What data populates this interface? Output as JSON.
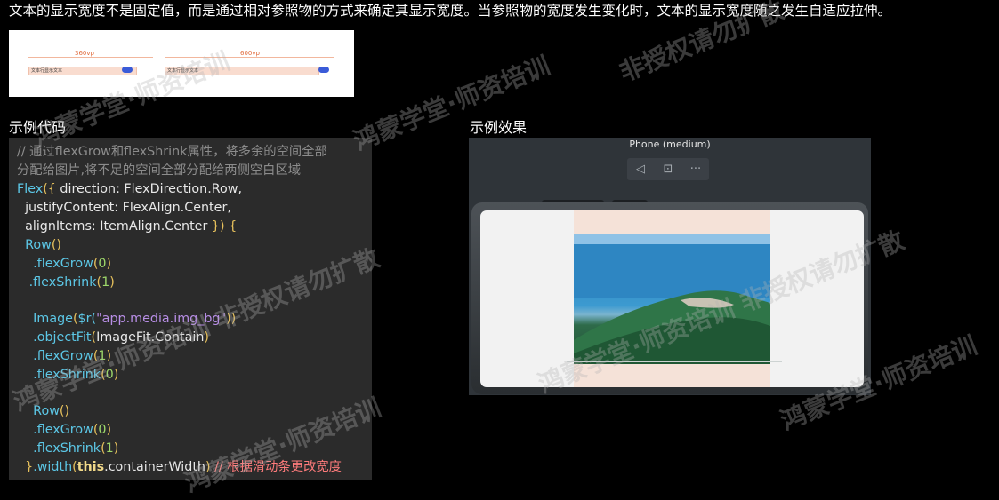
{
  "intro_text": "文本的显示宽度不是固定值，而是通过相对参照物的方式来确定其显示宽度。当参照物的宽度发生变化时，文本的显示宽度随之发生自适应拉伸。",
  "illustration": {
    "label_small": "360vp",
    "label_large": "600vp",
    "row_text": "文本行显示文本"
  },
  "sections": {
    "code_title": "示例代码",
    "effect_title": "示例效果"
  },
  "code_lines": {
    "l1_comment": "// 通过flexGrow和flexShrink属性，将多余的空间全部",
    "l2_comment": "分配给图片,将不足的空间全部分配给两侧空白区域",
    "l3_a": "Flex",
    "l3_b": "({ ",
    "l3_c": "direction: FlexDirection.Row,",
    "l4": "  justifyContent: FlexAlign.Center,",
    "l5_a": "  alignItems: ItemAlign.Center ",
    "l5_b": "}) {",
    "l6_a": "  Row",
    "l6_b": "()",
    "l7_a": "    .flexGrow",
    "l7_b": "(",
    "l7_c": "0",
    "l7_d": ")",
    "l8_a": "   .flexShrink",
    "l8_b": "(",
    "l8_c": "1",
    "l8_d": ")",
    "l10_a": "    Image",
    "l10_b": "(",
    "l10_c": "$r(",
    "l10_d": "\"app.media.img_bg\"",
    "l10_e": "))",
    "l11_a": "    .objectFit",
    "l11_b": "(",
    "l11_c": "ImageFit.Contain",
    "l11_d": ")",
    "l12_a": "    .flexGrow",
    "l12_b": "(",
    "l12_c": "1",
    "l12_d": ")",
    "l13_a": "    .flexShrink",
    "l13_b": "(",
    "l13_c": "0",
    "l13_d": ")",
    "l15_a": "    Row",
    "l15_b": "()",
    "l16_a": "    .flexGrow",
    "l16_b": "(",
    "l16_c": "0",
    "l16_d": ")",
    "l17_a": "    .flexShrink",
    "l17_b": "(",
    "l17_c": "1",
    "l17_d": ")",
    "l18_a": "  }",
    "l18_b": ".width",
    "l18_c": "(",
    "l18_d": "this",
    "l18_e": ".containerWidth",
    "l18_f": ")",
    "l18_g": " // 根据滑动条更改宽度"
  },
  "preview": {
    "device_label": "Phone (medium)",
    "toolbar": {
      "rotate_icon": "◁",
      "fold_icon": "⊡",
      "more_icon": "···"
    }
  },
  "watermark": {
    "text_a": "鸿蒙学堂·师资培训",
    "text_b": "非授权请勿扩散",
    "text_c": "鸿蒙学堂·师资培训  非授权请勿扩散"
  }
}
